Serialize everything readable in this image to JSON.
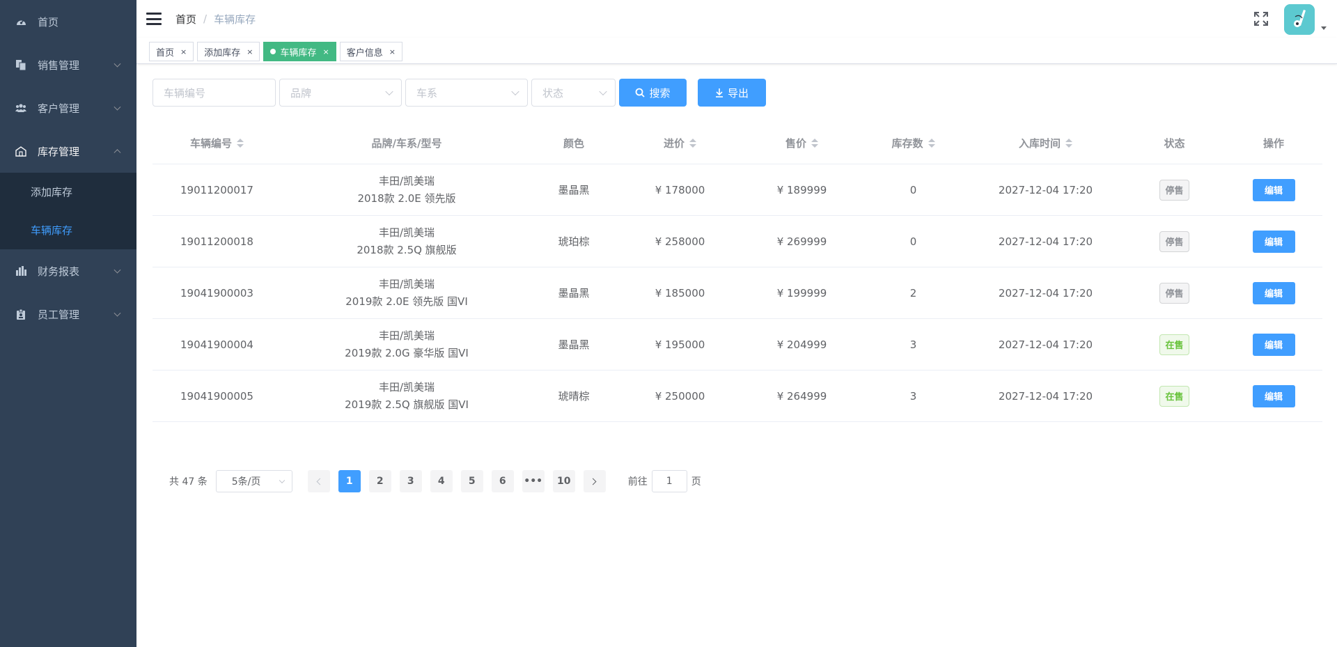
{
  "sidebar": {
    "items": [
      {
        "label": "首页",
        "icon": "dashboard-icon"
      },
      {
        "label": "销售管理",
        "icon": "document-icon"
      },
      {
        "label": "客户管理",
        "icon": "users-icon"
      },
      {
        "label": "库存管理",
        "icon": "warehouse-icon"
      },
      {
        "label": "财务报表",
        "icon": "bar-chart-icon"
      },
      {
        "label": "员工管理",
        "icon": "badge-icon"
      }
    ],
    "submenu": [
      {
        "label": "添加库存"
      },
      {
        "label": "车辆库存"
      }
    ]
  },
  "header": {
    "breadcrumb": {
      "home": "首页",
      "separator": "/",
      "current": "车辆库存"
    }
  },
  "tags": [
    {
      "label": "首页",
      "close": "×"
    },
    {
      "label": "添加库存",
      "close": "×"
    },
    {
      "label": "车辆库存",
      "close": "×"
    },
    {
      "label": "客户信息",
      "close": "×"
    }
  ],
  "filters": {
    "vehicle_no_placeholder": "车辆编号",
    "brand_placeholder": "品牌",
    "series_placeholder": "车系",
    "status_placeholder": "状态",
    "search_label": "搜索",
    "export_label": "导出"
  },
  "table": {
    "headers": {
      "vehicle_no": "车辆编号",
      "model": "品牌/车系/型号",
      "color": "颜色",
      "purchase_price": "进价",
      "sale_price": "售价",
      "stock": "库存数",
      "inbound_time": "入库时间",
      "status": "状态",
      "actions": "操作"
    },
    "rows": [
      {
        "vehicle_no": "19011200017",
        "model_line1": "丰田/凯美瑞",
        "model_line2": "2018款 2.0E 领先版",
        "color": "墨晶黑",
        "purchase_price": "¥ 178000",
        "sale_price": "¥ 189999",
        "stock": "0",
        "inbound_time": "2027-12-04 17:20",
        "status": "停售",
        "action": "编辑"
      },
      {
        "vehicle_no": "19011200018",
        "model_line1": "丰田/凯美瑞",
        "model_line2": "2018款 2.5Q 旗舰版",
        "color": "琥珀棕",
        "purchase_price": "¥ 258000",
        "sale_price": "¥ 269999",
        "stock": "0",
        "inbound_time": "2027-12-04 17:20",
        "status": "停售",
        "action": "编辑"
      },
      {
        "vehicle_no": "19041900003",
        "model_line1": "丰田/凯美瑞",
        "model_line2": "2019款 2.0E 领先版 国VI",
        "color": "墨晶黑",
        "purchase_price": "¥ 185000",
        "sale_price": "¥ 199999",
        "stock": "2",
        "inbound_time": "2027-12-04 17:20",
        "status": "停售",
        "action": "编辑"
      },
      {
        "vehicle_no": "19041900004",
        "model_line1": "丰田/凯美瑞",
        "model_line2": "2019款 2.0G 豪华版 国VI",
        "color": "墨晶黑",
        "purchase_price": "¥ 195000",
        "sale_price": "¥ 204999",
        "stock": "3",
        "inbound_time": "2027-12-04 17:20",
        "status": "在售",
        "action": "编辑"
      },
      {
        "vehicle_no": "19041900005",
        "model_line1": "丰田/凯美瑞",
        "model_line2": "2019款 2.5Q 旗舰版 国VI",
        "color": "琥晴棕",
        "purchase_price": "¥ 250000",
        "sale_price": "¥ 264999",
        "stock": "3",
        "inbound_time": "2027-12-04 17:20",
        "status": "在售",
        "action": "编辑"
      }
    ]
  },
  "pagination": {
    "total": "共 47 条",
    "page_size": "5条/页",
    "pages": [
      "1",
      "2",
      "3",
      "4",
      "5",
      "6",
      "•••",
      "10"
    ],
    "current_page": "1",
    "goto_label": "前往",
    "goto_value": "1",
    "page_unit": "页"
  },
  "colors": {
    "sidebar_bg": "#304156",
    "submenu_bg": "#1f2d3d",
    "primary": "#409eff",
    "active_tag": "#42b983",
    "on_sale": "#67c23a",
    "off_sale": "#909399"
  }
}
